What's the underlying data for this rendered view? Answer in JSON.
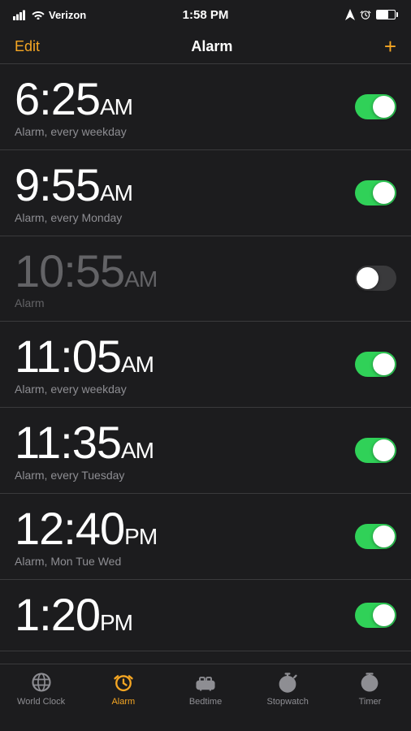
{
  "statusBar": {
    "carrier": "Verizon",
    "time": "1:58 PM",
    "batteryLevel": 70
  },
  "navBar": {
    "editLabel": "Edit",
    "title": "Alarm",
    "addLabel": "+"
  },
  "alarms": [
    {
      "time": "6:25",
      "ampm": "AM",
      "label": "Alarm, every weekday",
      "enabled": true,
      "disabled": false
    },
    {
      "time": "9:55",
      "ampm": "AM",
      "label": "Alarm, every Monday",
      "enabled": true,
      "disabled": false
    },
    {
      "time": "10:55",
      "ampm": "AM",
      "label": "Alarm",
      "enabled": false,
      "disabled": true
    },
    {
      "time": "11:05",
      "ampm": "AM",
      "label": "Alarm, every weekday",
      "enabled": true,
      "disabled": false
    },
    {
      "time": "11:35",
      "ampm": "AM",
      "label": "Alarm, every Tuesday",
      "enabled": true,
      "disabled": false
    },
    {
      "time": "12:40",
      "ampm": "PM",
      "label": "Alarm, Mon Tue Wed",
      "enabled": true,
      "disabled": false
    },
    {
      "time": "1:20",
      "ampm": "PM",
      "label": "",
      "enabled": true,
      "disabled": false,
      "partial": true
    }
  ],
  "tabBar": {
    "items": [
      {
        "id": "world-clock",
        "label": "World Clock",
        "active": false
      },
      {
        "id": "alarm",
        "label": "Alarm",
        "active": true
      },
      {
        "id": "bedtime",
        "label": "Bedtime",
        "active": false
      },
      {
        "id": "stopwatch",
        "label": "Stopwatch",
        "active": false
      },
      {
        "id": "timer",
        "label": "Timer",
        "active": false
      }
    ]
  }
}
